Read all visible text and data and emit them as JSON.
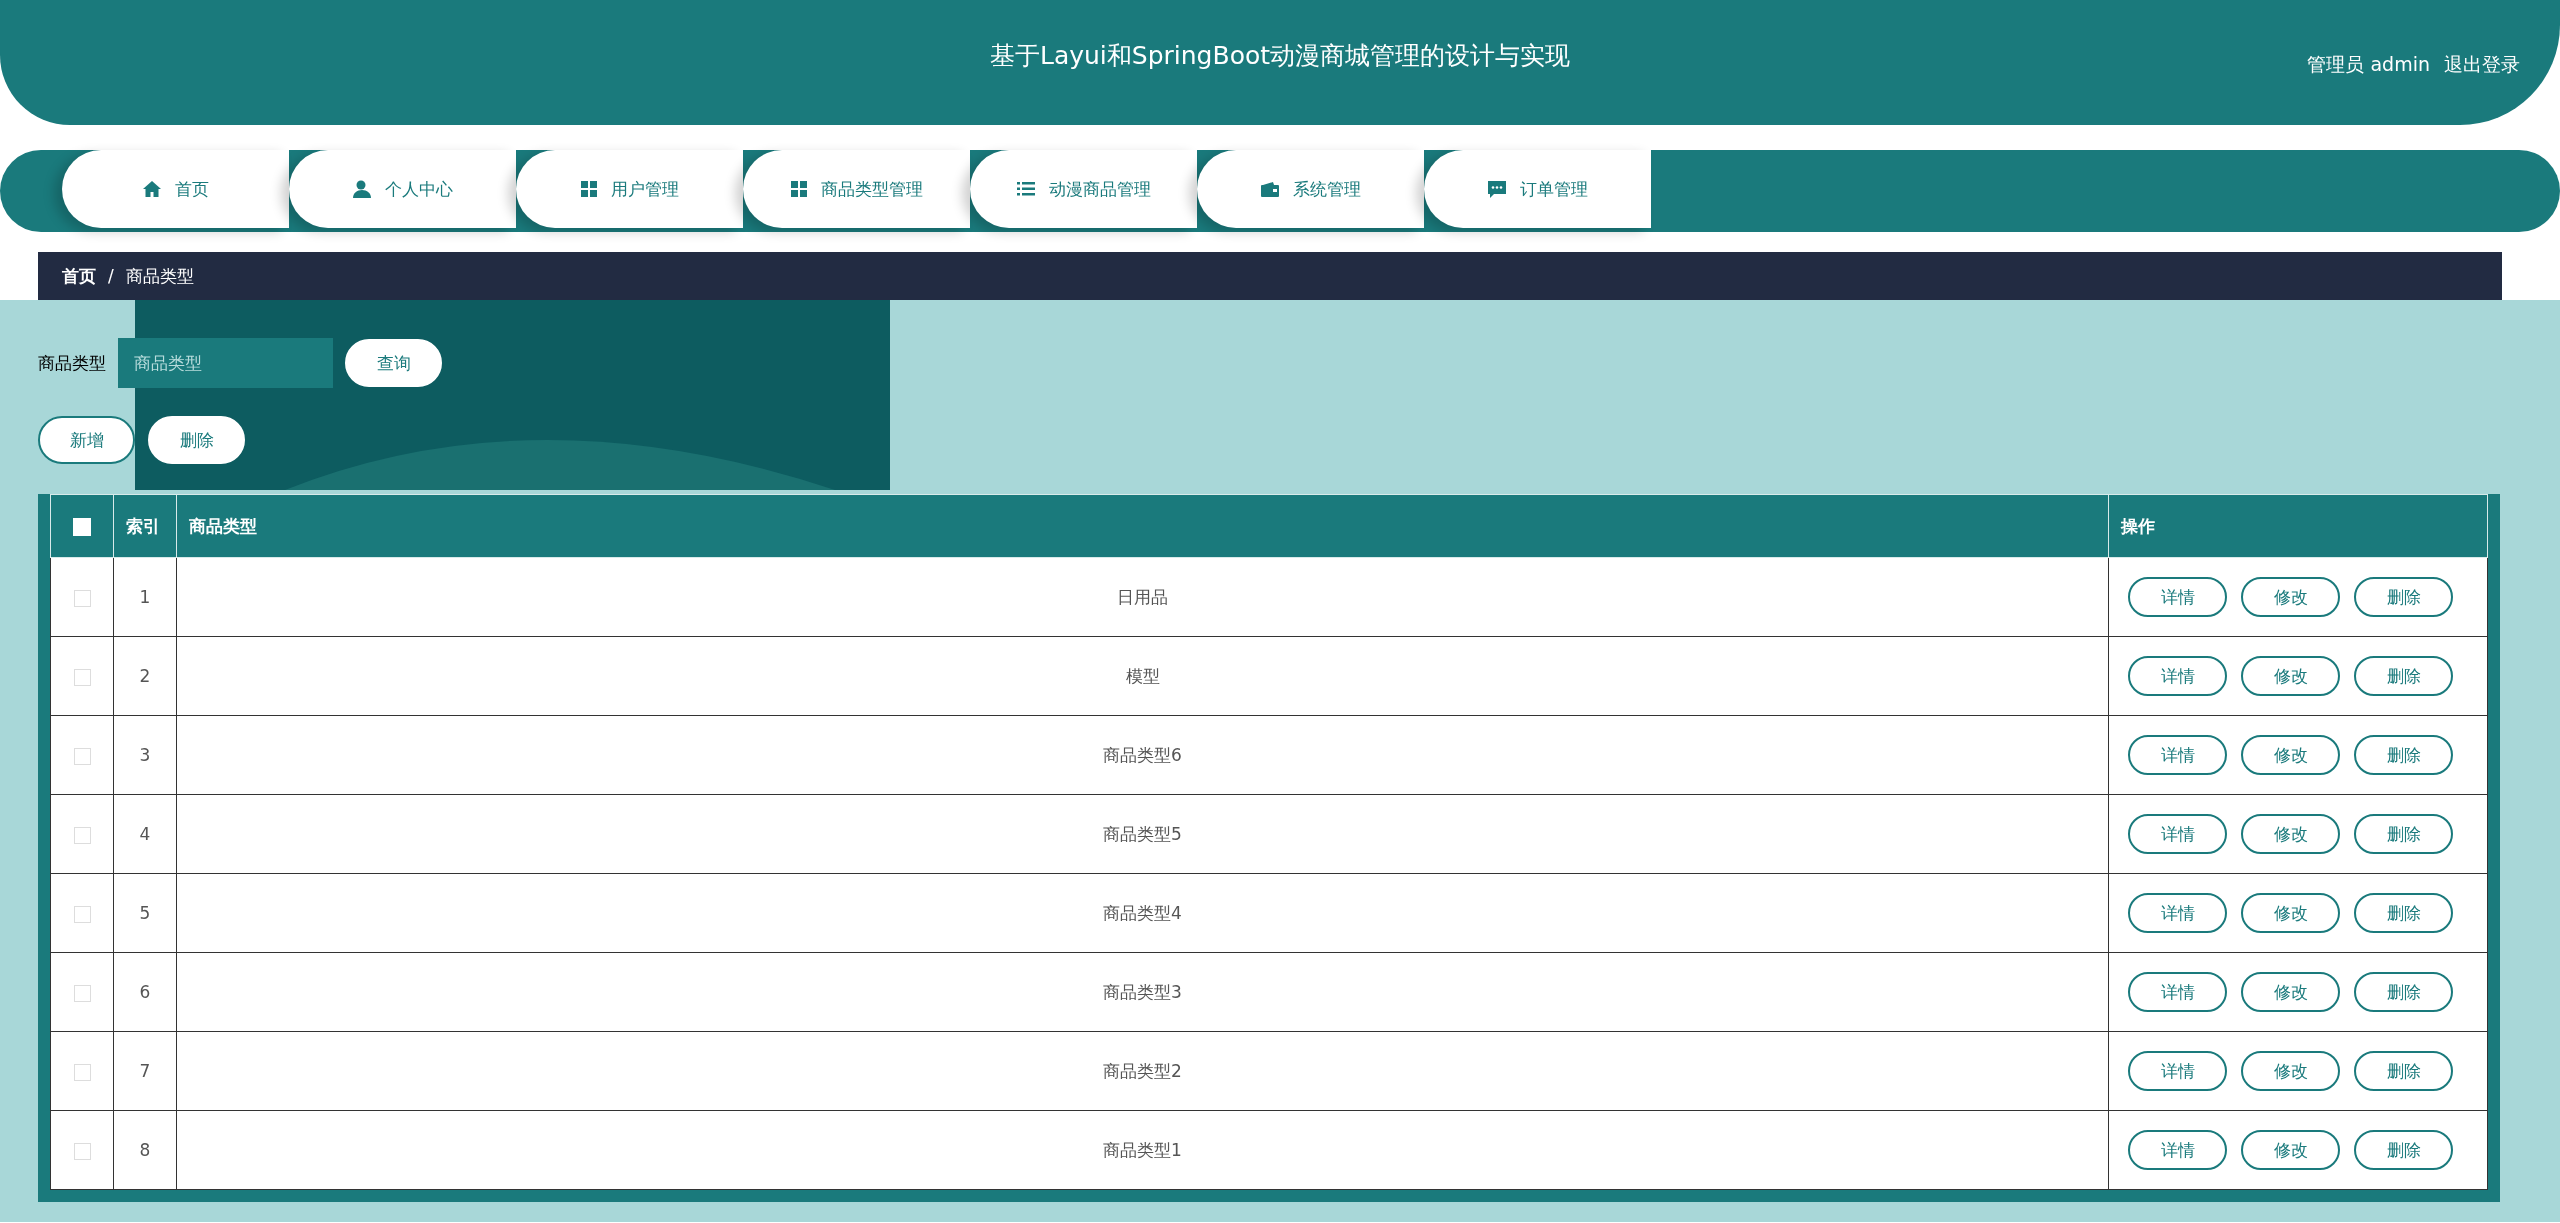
{
  "header": {
    "title": "基于Layui和SpringBoot动漫商城管理的设计与实现",
    "user_role": "管理员",
    "user_name": "admin",
    "logout": "退出登录"
  },
  "nav": [
    {
      "label": "首页",
      "selected": false
    },
    {
      "label": "个人中心",
      "selected": false
    },
    {
      "label": "用户管理",
      "selected": false
    },
    {
      "label": "商品类型管理",
      "selected": false
    },
    {
      "label": "动漫商品管理",
      "selected": false
    },
    {
      "label": "系统管理",
      "selected": false
    },
    {
      "label": "订单管理",
      "selected": false
    }
  ],
  "breadcrumb": [
    "首页",
    "商品类型"
  ],
  "breadcrumb_separator": "/",
  "search": {
    "label": "商品类型",
    "placeholder": "商品类型",
    "button": "查询"
  },
  "toolbar": [
    "新增",
    "删除"
  ],
  "table": {
    "columns": [
      "索引",
      "商品类型",
      "操作"
    ],
    "select_all_checked": false,
    "rows": [
      {
        "index": "1",
        "type": "日用品",
        "checked": false,
        "actions": [
          "详情",
          "修改",
          "删除"
        ]
      },
      {
        "index": "2",
        "type": "模型",
        "checked": false,
        "actions": [
          "详情",
          "修改",
          "删除"
        ]
      },
      {
        "index": "3",
        "type": "商品类型6",
        "checked": false,
        "actions": [
          "详情",
          "修改",
          "删除"
        ]
      },
      {
        "index": "4",
        "type": "商品类型5",
        "checked": false,
        "actions": [
          "详情",
          "修改",
          "删除"
        ]
      },
      {
        "index": "5",
        "type": "商品类型4",
        "checked": false,
        "actions": [
          "详情",
          "修改",
          "删除"
        ]
      },
      {
        "index": "6",
        "type": "商品类型3",
        "checked": false,
        "actions": [
          "详情",
          "修改",
          "删除"
        ]
      },
      {
        "index": "7",
        "type": "商品类型2",
        "checked": false,
        "actions": [
          "详情",
          "修改",
          "删除"
        ]
      },
      {
        "index": "8",
        "type": "商品类型1",
        "checked": false,
        "actions": [
          "详情",
          "修改",
          "删除"
        ]
      }
    ]
  }
}
